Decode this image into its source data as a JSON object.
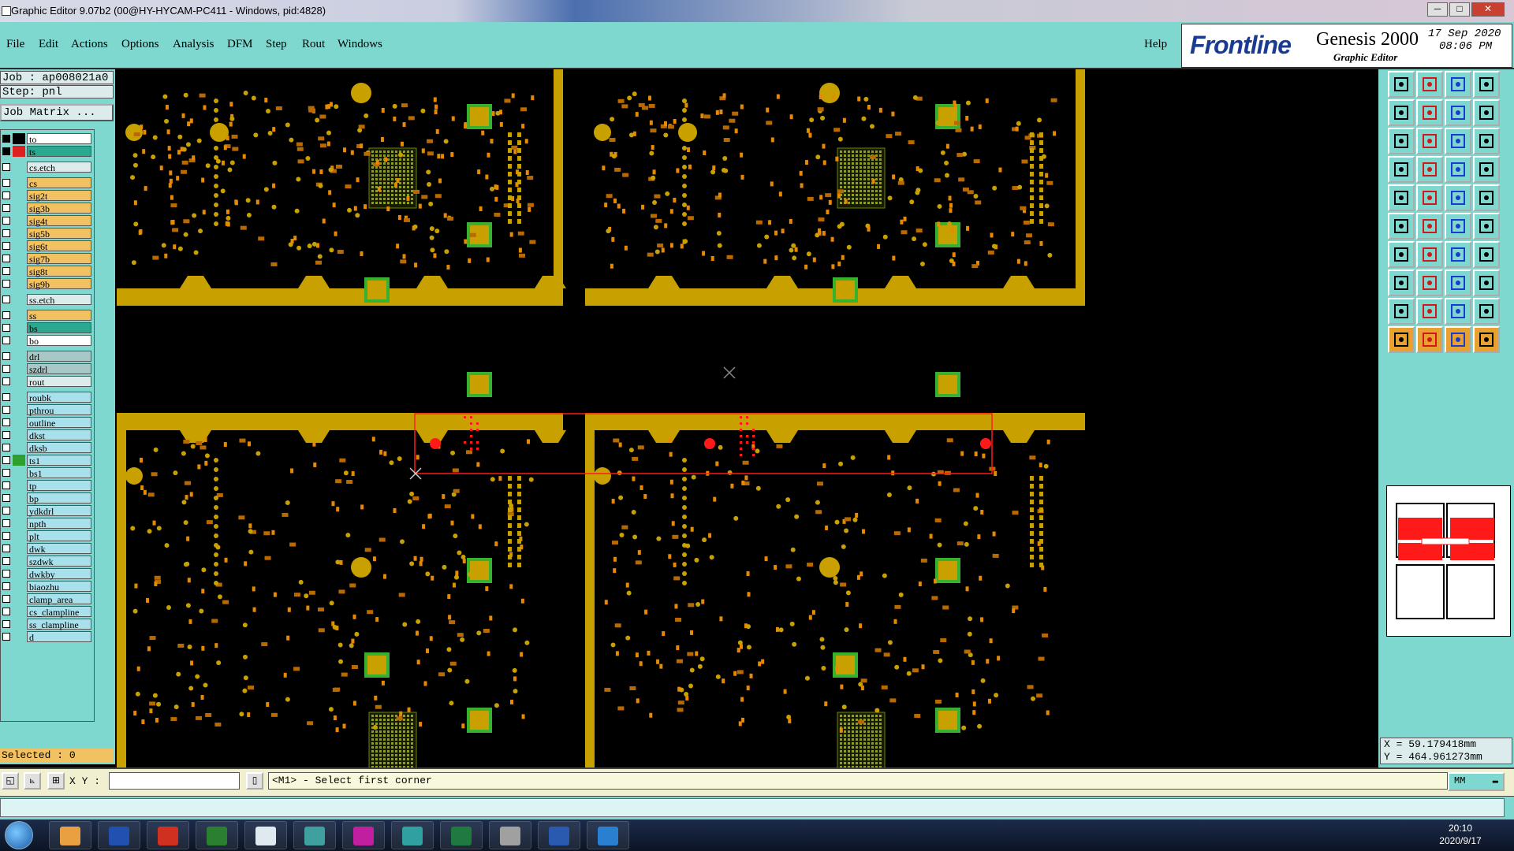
{
  "window": {
    "title": "Graphic Editor 9.07b2 (00@HY-HYCAM-PC411 - Windows, pid:4828)",
    "minimize": "─",
    "maximize": "□",
    "close": "✕"
  },
  "menu": [
    "File",
    "Edit",
    "Actions",
    "Options",
    "Analysis",
    "DFM",
    "Step",
    "Rout",
    "Windows"
  ],
  "help": "Help",
  "brand": {
    "logo": "Frontline",
    "product": "Genesis 2000",
    "subtitle": "Graphic Editor",
    "date_line1": "17  Sep  2020",
    "date_line2": "08:06 PM"
  },
  "job": {
    "job_label": "Job  :  ap008021a0",
    "step_label": "Step:  pnl",
    "matrix_label": "Job Matrix ..."
  },
  "layers": [
    {
      "name": "to",
      "color": "#ffffff",
      "swatch": "#000000",
      "checked": true
    },
    {
      "name": "ts",
      "color": "#2aa890",
      "swatch": "#e02020",
      "checked": true
    },
    {
      "name": "cs.etch",
      "color": "#dcecec",
      "swatch": "#7fd8d0",
      "checked": false
    },
    {
      "name": "cs",
      "color": "#f2c262",
      "swatch": "#7fd8d0",
      "checked": false
    },
    {
      "name": "sig2t",
      "color": "#f2c262",
      "swatch": "#7fd8d0",
      "checked": false
    },
    {
      "name": "sig3b",
      "color": "#f2c262",
      "swatch": "#7fd8d0",
      "checked": false
    },
    {
      "name": "sig4t",
      "color": "#f2c262",
      "swatch": "#7fd8d0",
      "checked": false
    },
    {
      "name": "sig5b",
      "color": "#f2c262",
      "swatch": "#7fd8d0",
      "checked": false
    },
    {
      "name": "sig6t",
      "color": "#f2c262",
      "swatch": "#7fd8d0",
      "checked": false
    },
    {
      "name": "sig7b",
      "color": "#f2c262",
      "swatch": "#7fd8d0",
      "checked": false
    },
    {
      "name": "sig8t",
      "color": "#f2c262",
      "swatch": "#7fd8d0",
      "checked": false
    },
    {
      "name": "sig9b",
      "color": "#f2c262",
      "swatch": "#7fd8d0",
      "checked": false
    },
    {
      "name": "ss.etch",
      "color": "#dcecec",
      "swatch": "#7fd8d0",
      "checked": false
    },
    {
      "name": "ss",
      "color": "#f2c262",
      "swatch": "#7fd8d0",
      "checked": false
    },
    {
      "name": "bs",
      "color": "#2aa890",
      "swatch": "#7fd8d0",
      "checked": false
    },
    {
      "name": "bo",
      "color": "#ffffff",
      "swatch": "#7fd8d0",
      "checked": false
    },
    {
      "name": "drl",
      "color": "#a8c8c8",
      "swatch": "#7fd8d0",
      "checked": false
    },
    {
      "name": "szdrl",
      "color": "#a8c8c8",
      "swatch": "#7fd8d0",
      "checked": false
    },
    {
      "name": "rout",
      "color": "#dcecec",
      "swatch": "#7fd8d0",
      "checked": false
    },
    {
      "name": "roubk",
      "color": "#a8e0ec",
      "swatch": "#7fd8d0",
      "checked": false
    },
    {
      "name": "pthrou",
      "color": "#a8e0ec",
      "swatch": "#7fd8d0",
      "checked": false
    },
    {
      "name": "outline",
      "color": "#a8e0ec",
      "swatch": "#7fd8d0",
      "checked": false
    },
    {
      "name": "dkst",
      "color": "#a8e0ec",
      "swatch": "#7fd8d0",
      "checked": false
    },
    {
      "name": "dksb",
      "color": "#a8e0ec",
      "swatch": "#7fd8d0",
      "checked": false
    },
    {
      "name": "ts1",
      "color": "#a8e0ec",
      "swatch": "#2ea02e",
      "checked": false
    },
    {
      "name": "bs1",
      "color": "#a8e0ec",
      "swatch": "#7fd8d0",
      "checked": false
    },
    {
      "name": "tp",
      "color": "#a8e0ec",
      "swatch": "#7fd8d0",
      "checked": false
    },
    {
      "name": "bp",
      "color": "#a8e0ec",
      "swatch": "#7fd8d0",
      "checked": false
    },
    {
      "name": "ydkdrl",
      "color": "#a8e0ec",
      "swatch": "#7fd8d0",
      "checked": false
    },
    {
      "name": "npth",
      "color": "#a8e0ec",
      "swatch": "#7fd8d0",
      "checked": false
    },
    {
      "name": "plt",
      "color": "#a8e0ec",
      "swatch": "#7fd8d0",
      "checked": false
    },
    {
      "name": "dwk",
      "color": "#a8e0ec",
      "swatch": "#7fd8d0",
      "checked": false
    },
    {
      "name": "szdwk",
      "color": "#a8e0ec",
      "swatch": "#7fd8d0",
      "checked": false
    },
    {
      "name": "dwkby",
      "color": "#a8e0ec",
      "swatch": "#7fd8d0",
      "checked": false
    },
    {
      "name": "biaozhu",
      "color": "#a8e0ec",
      "swatch": "#7fd8d0",
      "checked": false
    },
    {
      "name": "clamp_area",
      "color": "#a8e0ec",
      "swatch": "#7fd8d0",
      "checked": false
    },
    {
      "name": "cs_clampline",
      "color": "#a8e0ec",
      "swatch": "#7fd8d0",
      "checked": false
    },
    {
      "name": "ss_clampline",
      "color": "#a8e0ec",
      "swatch": "#7fd8d0",
      "checked": false
    },
    {
      "name": "d",
      "color": "#a8e0ec",
      "swatch": "#7fd8d0",
      "checked": false
    }
  ],
  "selected_label": "Selected : 0",
  "coords": {
    "x": "X =  59.179418mm",
    "y": "Y =  464.961273mm"
  },
  "status": {
    "xy_label": "X Y :",
    "xy_value": "",
    "prompt": "<M1> - Select first corner",
    "units": "MM"
  },
  "taskbar": {
    "time": "20:10",
    "date": "2020/9/17"
  },
  "colors": {
    "copper": "#c8a000",
    "pad_orange": "#e88a00",
    "pad_green": "#38b030",
    "highlight_red": "#ff1a1a",
    "bg_teal": "#7fd8d0"
  }
}
